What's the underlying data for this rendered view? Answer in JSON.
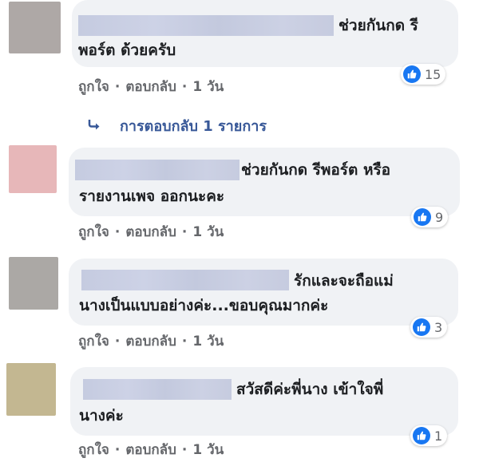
{
  "comments": [
    {
      "text_line1": "ช่วยกันกด รี",
      "text_line2": "พอร์ต ด้วยครับ",
      "reaction_count": "15",
      "avatar_color": "#aea8a6",
      "actions": {
        "like": "ถูกใจ",
        "reply": "ตอบกลับ",
        "time": "1 วัน"
      }
    },
    {
      "text_line1": "ช่วยกันกด รีพอร์ต หรือ",
      "text_line2": "รายงานเพจ ออกนะคะ",
      "reaction_count": "9",
      "avatar_color": "#e7b7b9",
      "actions": {
        "like": "ถูกใจ",
        "reply": "ตอบกลับ",
        "time": "1 วัน"
      }
    },
    {
      "text_line1": "รักและจะถือแม่",
      "text_line2": "นางเป็นแบบอย่างค่ะ...ขอบคุณมากค่ะ",
      "reaction_count": "3",
      "avatar_color": "#aba8a5",
      "actions": {
        "like": "ถูกใจ",
        "reply": "ตอบกลับ",
        "time": "1 วัน"
      }
    },
    {
      "text_line1": "สวัสดีค่ะพี่นาง เข้าใจพี่",
      "text_line2": "นางค่ะ",
      "reaction_count": "1",
      "avatar_color": "#c3b791",
      "actions": {
        "like": "ถูกใจ",
        "reply": "ตอบกลับ",
        "time": "1 วัน"
      }
    }
  ],
  "separator": "·",
  "replies_link": "การตอบกลับ 1 รายการ",
  "colors": {
    "like_blue": "#1877f2",
    "link_blue": "#385898",
    "bubble_bg": "#f0f2f5",
    "meta_gray": "#65676b"
  },
  "icons": {
    "like": "thumbs-up-icon",
    "reply_arrow": "reply-arrow-icon"
  }
}
